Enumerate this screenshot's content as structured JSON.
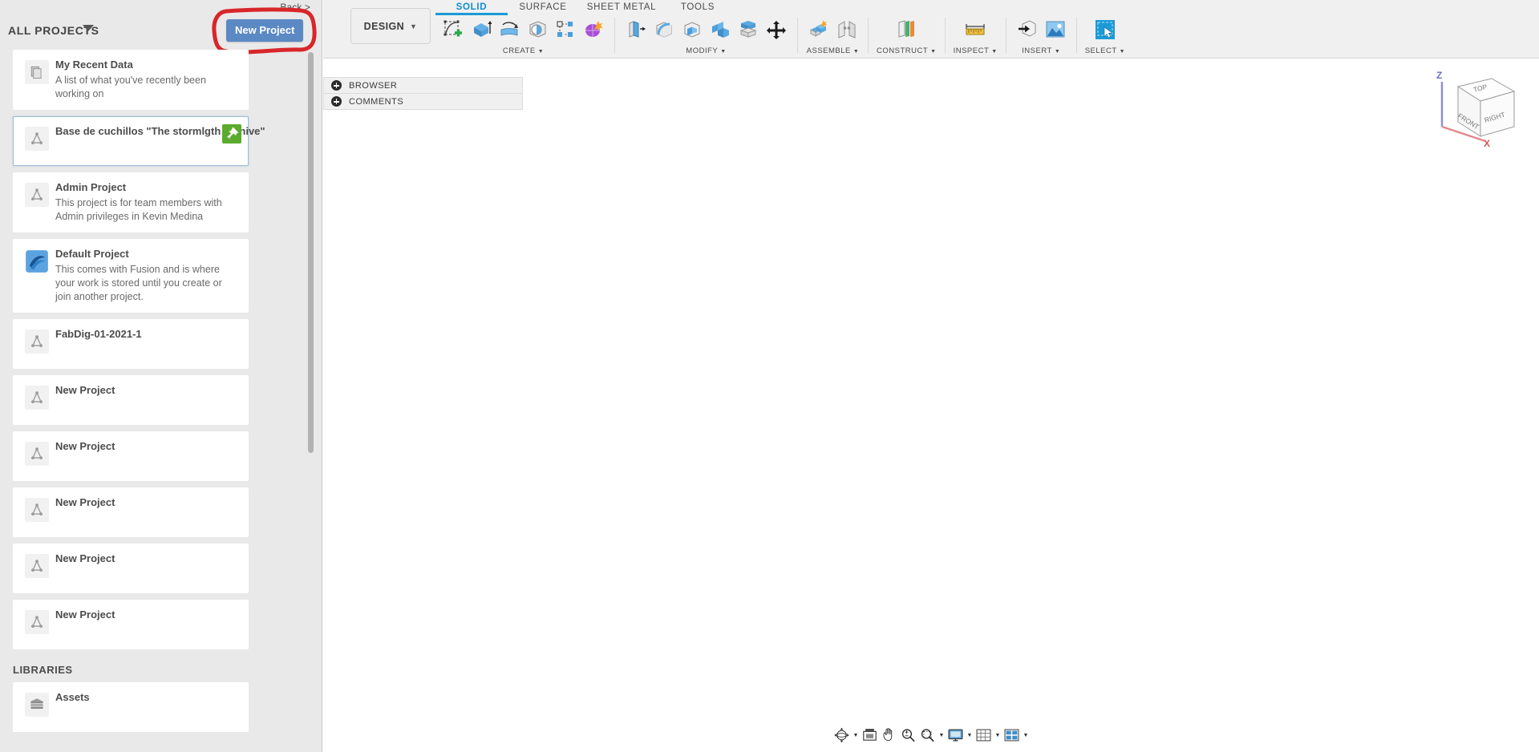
{
  "data_panel": {
    "back_link": "Back >",
    "header_label": "ALL PROJECTS",
    "new_project_button": "New Project",
    "libraries_header": "LIBRARIES",
    "projects": [
      {
        "title": "My Recent Data",
        "description": "A list of what you've recently been working on",
        "icon": "documents-icon",
        "selected": false,
        "pinned": false
      },
      {
        "title": "Base de cuchillos \"The stormlgth archive\"",
        "description": "",
        "icon": "project-triangle-icon",
        "selected": true,
        "pinned": true
      },
      {
        "title": "Admin Project",
        "description": "This project is for team members with Admin privileges in Kevin Medina",
        "icon": "project-triangle-icon",
        "selected": false,
        "pinned": false
      },
      {
        "title": "Default Project",
        "description": "This comes with Fusion and is where your work is stored until you create or join another project.",
        "icon": "fusion-swirl-icon",
        "selected": false,
        "pinned": false
      },
      {
        "title": "FabDig-01-2021-1",
        "description": "",
        "icon": "project-triangle-icon",
        "selected": false,
        "pinned": false
      },
      {
        "title": "New Project",
        "description": "",
        "icon": "project-triangle-icon",
        "selected": false,
        "pinned": false
      },
      {
        "title": "New Project",
        "description": "",
        "icon": "project-triangle-icon",
        "selected": false,
        "pinned": false
      },
      {
        "title": "New Project",
        "description": "",
        "icon": "project-triangle-icon",
        "selected": false,
        "pinned": false
      },
      {
        "title": "New Project",
        "description": "",
        "icon": "project-triangle-icon",
        "selected": false,
        "pinned": false
      },
      {
        "title": "New Project",
        "description": "",
        "icon": "project-triangle-icon",
        "selected": false,
        "pinned": false
      }
    ],
    "libraries": [
      {
        "title": "Assets",
        "icon": "assets-stack-icon"
      }
    ]
  },
  "app": {
    "design_menu": "DESIGN",
    "tabs": [
      {
        "label": "SOLID",
        "active": true
      },
      {
        "label": "SURFACE",
        "active": false
      },
      {
        "label": "SHEET METAL",
        "active": false
      },
      {
        "label": "TOOLS",
        "active": false
      }
    ],
    "ribbon_groups": [
      {
        "label": "CREATE",
        "icons": [
          "create-sketch-icon",
          "extrude-icon",
          "revolve-icon",
          "sphere-icon",
          "pattern-icon",
          "form-icon"
        ]
      },
      {
        "label": "MODIFY",
        "icons": [
          "press-pull-icon",
          "fillet-icon",
          "shell-icon",
          "combine-icon",
          "split-face-icon",
          "move-copy-icon"
        ]
      },
      {
        "label": "ASSEMBLE",
        "icons": [
          "new-component-icon",
          "joint-icon"
        ]
      },
      {
        "label": "CONSTRUCT",
        "icons": [
          "offset-plane-icon"
        ]
      },
      {
        "label": "INSPECT",
        "icons": [
          "measure-icon"
        ]
      },
      {
        "label": "INSERT",
        "icons": [
          "insert-derive-icon",
          "insert-canvas-icon"
        ]
      },
      {
        "label": "SELECT",
        "icons": [
          "select-window-icon"
        ]
      }
    ],
    "side_panels": [
      {
        "label": "BROWSER"
      },
      {
        "label": "COMMENTS"
      }
    ],
    "viewcube": {
      "top_face": "TOP",
      "front_face": "FRONT",
      "right_face": "RIGHT",
      "axis_z": "Z",
      "axis_x": "X"
    },
    "nav_bar": [
      {
        "icon": "orbit-icon",
        "has_caret": true
      },
      {
        "icon": "look-at-icon",
        "has_caret": false
      },
      {
        "icon": "pan-icon",
        "has_caret": false
      },
      {
        "icon": "zoom-icon",
        "has_caret": false
      },
      {
        "icon": "zoom-window-icon",
        "has_caret": true
      },
      {
        "icon": "display-settings-icon",
        "has_caret": true
      },
      {
        "icon": "grid-snaps-icon",
        "has_caret": true
      },
      {
        "icon": "viewports-icon",
        "has_caret": true
      }
    ]
  },
  "colors": {
    "accent_blue": "#1b9ad6",
    "button_blue": "#5b89c4",
    "annotation_red": "#d8262a",
    "pin_green": "#5aab2e",
    "panel_grey": "#e9e9e9"
  }
}
